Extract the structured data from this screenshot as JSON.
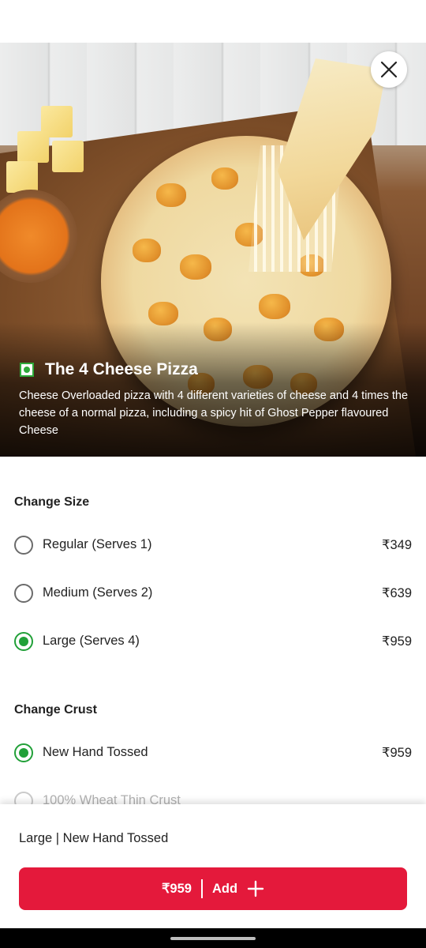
{
  "product": {
    "title": "The 4 Cheese Pizza",
    "description": "Cheese Overloaded pizza with 4 different varieties of cheese and 4 times the cheese of a normal pizza, including a spicy hit of Ghost Pepper flavoured Cheese",
    "veg_indicator_color": "#2eaa3a"
  },
  "size_section": {
    "title": "Change Size",
    "options": [
      {
        "label": "Regular (Serves 1)",
        "price": "₹349",
        "selected": false
      },
      {
        "label": "Medium (Serves 2)",
        "price": "₹639",
        "selected": false
      },
      {
        "label": "Large (Serves 4)",
        "price": "₹959",
        "selected": true
      }
    ]
  },
  "crust_section": {
    "title": "Change Crust",
    "options": [
      {
        "label": "New Hand Tossed",
        "price": "₹959",
        "selected": true
      },
      {
        "label": "100% Wheat Thin Crust",
        "price": "",
        "selected": false
      }
    ]
  },
  "footer": {
    "summary": "Large | New Hand Tossed",
    "price": "₹959",
    "add_label": "Add"
  },
  "colors": {
    "accent_red": "#e4193b",
    "radio_selected": "#21a038"
  },
  "icons": {
    "close": "close-icon",
    "add": "plus-icon",
    "veg": "veg-indicator-icon"
  }
}
